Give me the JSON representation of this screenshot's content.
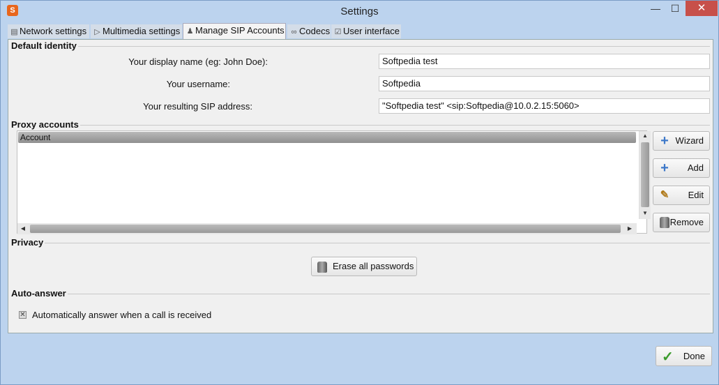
{
  "window": {
    "title": "Settings",
    "close_glyph": "✕",
    "min_glyph": "—",
    "max_glyph": "☐"
  },
  "tabs": [
    {
      "label": "Network settings",
      "icon": "network-icon"
    },
    {
      "label": "Multimedia settings",
      "icon": "play-icon"
    },
    {
      "label": "Manage SIP Accounts",
      "icon": "users-icon"
    },
    {
      "label": "Codecs",
      "icon": "link-icon"
    },
    {
      "label": "User interface",
      "icon": "checklist-icon"
    }
  ],
  "default_identity": {
    "title": "Default identity",
    "display_name_label": "Your display name (eg: John Doe):",
    "display_name_value": "Softpedia test",
    "username_label": "Your username:",
    "username_value": "Softpedia",
    "sip_label": "Your resulting SIP address:",
    "sip_value": "\"Softpedia test\" <sip:Softpedia@10.0.2.15:5060>"
  },
  "proxy_accounts": {
    "title": "Proxy accounts",
    "column_header": "Account",
    "buttons": {
      "wizard": "Wizard",
      "add": "Add",
      "edit": "Edit",
      "remove": "Remove"
    }
  },
  "privacy": {
    "title": "Privacy",
    "erase_button": "Erase all passwords"
  },
  "auto_answer": {
    "title": "Auto-answer",
    "checkbox_label": "Automatically answer when a call is received",
    "checked": true
  },
  "footer": {
    "done_button": "Done"
  },
  "colors": {
    "close_button": "#c7504a",
    "accent_icon": "#3d78c9",
    "done_check": "#3a9b2c"
  }
}
